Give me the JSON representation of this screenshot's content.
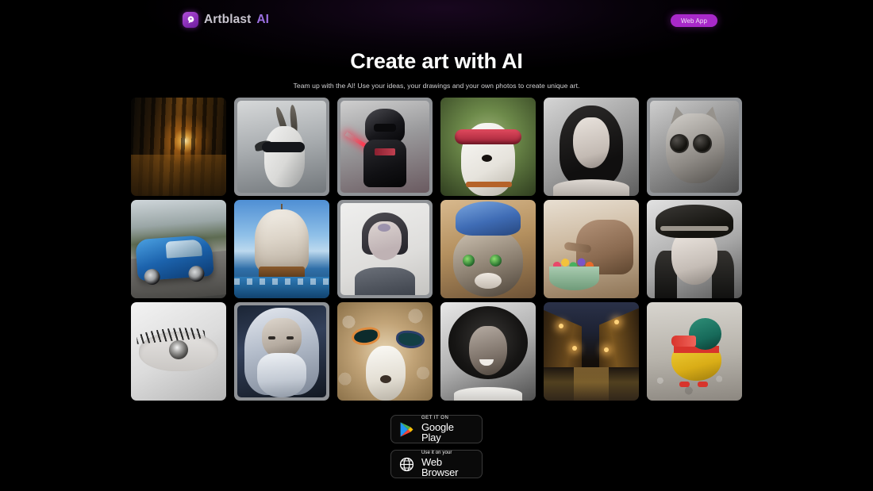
{
  "brand": {
    "name": "Artblast",
    "suffix": "AI",
    "mark_icon": "artblast-logo-icon",
    "accent_color": "#9b6fe0"
  },
  "header": {
    "web_app_label": "Web App",
    "web_app_color": "#a829c9"
  },
  "hero": {
    "title": "Create art with AI",
    "subtitle": "Team up with the AI! Use your ideas, your drawings and your own photos to create unique art."
  },
  "gallery": {
    "tiles": [
      {
        "id": "forest-sunrise",
        "alt": "Sunbeams through a dark forest"
      },
      {
        "id": "goat-sunglasses",
        "alt": "Black and white goat wearing sunglasses"
      },
      {
        "id": "darth-vader-figure",
        "alt": "Toy Darth Vader figure with red lightsaber"
      },
      {
        "id": "dog-red-sunglasses",
        "alt": "Dog wearing large red sunglasses"
      },
      {
        "id": "woman-portrait-bw",
        "alt": "Black and white portrait of a woman"
      },
      {
        "id": "cat-sunglasses-bw",
        "alt": "Black and white cat wearing round sunglasses"
      },
      {
        "id": "blue-sports-car",
        "alt": "Blue sports car on a mountain road"
      },
      {
        "id": "tall-ship",
        "alt": "Tall sailing ship on the ocean"
      },
      {
        "id": "painted-portrait",
        "alt": "Painted sketch portrait of a person"
      },
      {
        "id": "cat-blue-hat",
        "alt": "Cat wearing a blue hat"
      },
      {
        "id": "wooden-elephant",
        "alt": "Wooden elephant with a bowl of candy"
      },
      {
        "id": "woman-fedora-bw",
        "alt": "Smiling woman in a fedora, black and white"
      },
      {
        "id": "closeup-eye-bw",
        "alt": "Close-up of an eye, black and white"
      },
      {
        "id": "wizard-old-man",
        "alt": "Old man with long white hair and beard"
      },
      {
        "id": "dog-two-sunglasses",
        "alt": "Fluffy dog wearing two pairs of sunglasses"
      },
      {
        "id": "woman-afro-bw",
        "alt": "Smiling woman with afro, black and white"
      },
      {
        "id": "night-street",
        "alt": "Lamp-lit cobblestone street at night"
      },
      {
        "id": "toy-duck",
        "alt": "Colorful wooden toy duck"
      }
    ]
  },
  "badges": [
    {
      "id": "google-play-badge",
      "icon": "google-play-icon",
      "line1": "GET IT ON",
      "line2": "Google Play"
    },
    {
      "id": "web-browser-badge",
      "icon": "globe-icon",
      "line1": "Use it on your",
      "line2": "Web Browser"
    }
  ]
}
